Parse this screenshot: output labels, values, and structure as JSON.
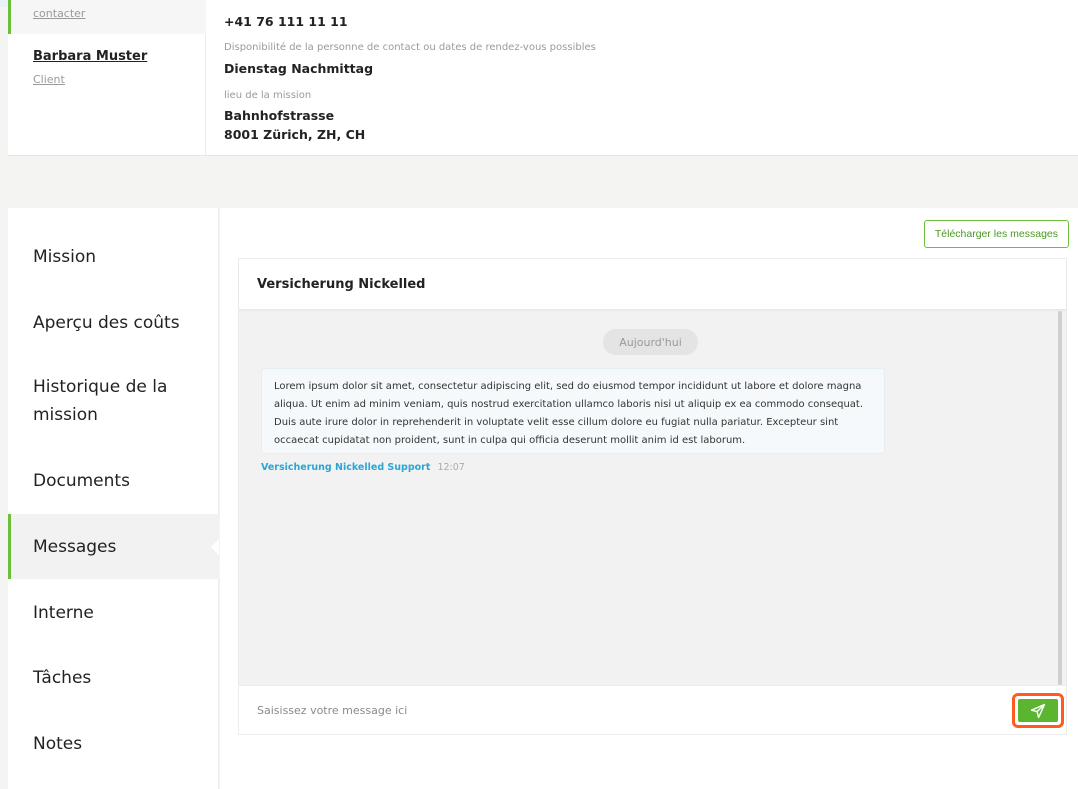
{
  "contact_card": {
    "contacts": [
      {
        "name": "",
        "role": "contacter"
      },
      {
        "name": "Barbara Muster",
        "role": "Client"
      }
    ],
    "phone": "+41 76 111 11 11",
    "availability_label": "Disponibilité de la personne de contact ou dates de rendez-vous possibles",
    "availability_value": "Dienstag Nachmittag",
    "location_label": "lieu de la mission",
    "location_street": "Bahnhofstrasse",
    "location_city": "8001 Zürich, ZH, CH"
  },
  "sidebar": {
    "items": [
      {
        "label": "Mission",
        "active": false
      },
      {
        "label": "Aperçu des coûts",
        "active": false
      },
      {
        "label": "Historique de la mission",
        "active": false
      },
      {
        "label": "Documents",
        "active": false
      },
      {
        "label": "Messages",
        "active": true
      },
      {
        "label": "Interne",
        "active": false
      },
      {
        "label": "Tâches",
        "active": false
      },
      {
        "label": "Notes",
        "active": false
      }
    ]
  },
  "messages_panel": {
    "download_label": "Télécharger les messages",
    "chat_title": "Versicherung Nickelled",
    "date_separator": "Aujourd'hui",
    "messages": [
      {
        "text": "Lorem ipsum dolor sit amet, consectetur adipiscing elit, sed do eiusmod tempor incididunt ut labore et dolore magna aliqua. Ut enim ad minim veniam, quis nostrud exercitation ullamco laboris nisi ut aliquip ex ea commodo consequat. Duis aute irure dolor in reprehenderit in voluptate velit esse cillum dolore eu fugiat nulla pariatur. Excepteur sint occaecat cupidatat non proident, sunt in culpa qui officia deserunt mollit anim id est laborum.",
        "sender": "Versicherung Nickelled Support",
        "time": "12:07"
      }
    ],
    "composer_placeholder": "Saisissez votre message ici",
    "send_icon": "paper-plane-icon"
  },
  "colors": {
    "accent_green": "#6cbf3a",
    "send_green": "#5cb531",
    "highlight_orange": "#ff5a1f",
    "sender_blue": "#2aa6d4"
  }
}
